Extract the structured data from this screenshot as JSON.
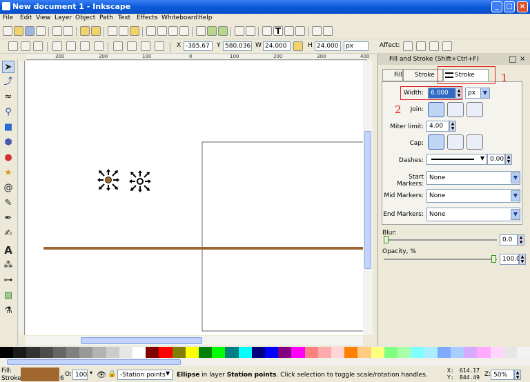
{
  "window": {
    "title": "New document 1 - Inkscape"
  },
  "menu": [
    "File",
    "Edit",
    "View",
    "Layer",
    "Object",
    "Path",
    "Text",
    "Effects",
    "Whiteboard",
    "Help"
  ],
  "toolcontrols": {
    "x_label": "X",
    "x_value": "-385.67",
    "y_label": "Y",
    "y_value": "580.036",
    "w_label": "W",
    "w_value": "24.000",
    "h_label": "H",
    "h_value": "24.000",
    "unit": "px",
    "affect_label": "Affect:"
  },
  "ruler": {
    "h_ticks": [
      "300",
      "200",
      "100",
      "0",
      "100",
      "200",
      "300",
      "400"
    ]
  },
  "panel": {
    "title": "Fill and Stroke (Shift+Ctrl+F)",
    "tabs": [
      "Fill",
      "Stroke paint",
      "Stroke style"
    ],
    "width_label": "Width:",
    "width_value": "6.000",
    "width_unit": "px",
    "join_label": "Join:",
    "miter_label": "Miter limit:",
    "miter_value": "4.00",
    "cap_label": "Cap:",
    "dashes_label": "Dashes:",
    "dashes_value": "0.00",
    "start_markers_label": "Start Markers:",
    "start_markers_value": "None",
    "mid_markers_label": "Mid Markers:",
    "mid_markers_value": "None",
    "end_markers_label": "End Markers:",
    "end_markers_value": "None",
    "blur_label": "Blur:",
    "blur_value": "0.0",
    "opacity_label": "Opacity, %",
    "opacity_value": "100.0"
  },
  "annotations": {
    "mark1": "1",
    "mark2": "2"
  },
  "palette_colors": [
    "#000000",
    "#1a1a1a",
    "#333333",
    "#4d4d4d",
    "#666666",
    "#808080",
    "#999999",
    "#b3b3b3",
    "#cccccc",
    "#e6e6e6",
    "#ffffff",
    "#800000",
    "#ff0000",
    "#808000",
    "#ffff00",
    "#008000",
    "#00ff00",
    "#008080",
    "#00ffff",
    "#000080",
    "#0000ff",
    "#800080",
    "#ff00ff",
    "#ff8080",
    "#ffaaaa",
    "#ffd5d5",
    "#ff8000",
    "#ffcc80",
    "#ffff80",
    "#80ff80",
    "#aaffaa",
    "#80ffff",
    "#aaeeff",
    "#80aaff",
    "#aaccff",
    "#d5aaff",
    "#ffaaff",
    "#ffd5ff",
    "#e6e6e6",
    "#f2f2f2"
  ],
  "status": {
    "fill_label": "Fill:",
    "stroke_label": "Stroke:",
    "stroke_width": "6",
    "fill_color": "#a0672f",
    "opacity_label": "O:",
    "opacity_value": "100",
    "layer_name": "-Station points",
    "message_bold1": "Ellipse",
    "message_mid": " in layer ",
    "message_bold2": "Station points",
    "message_end": ". Click selection to toggle scale/rotation handles.",
    "cursor_x_label": "X:",
    "cursor_x": "614.17",
    "cursor_y_label": "Y:",
    "cursor_y": "844.49",
    "zoom_label": "Z:",
    "zoom_value": "50%"
  },
  "colors": {
    "stroke_line": "#9c6430",
    "accent_red": "#e02020"
  }
}
